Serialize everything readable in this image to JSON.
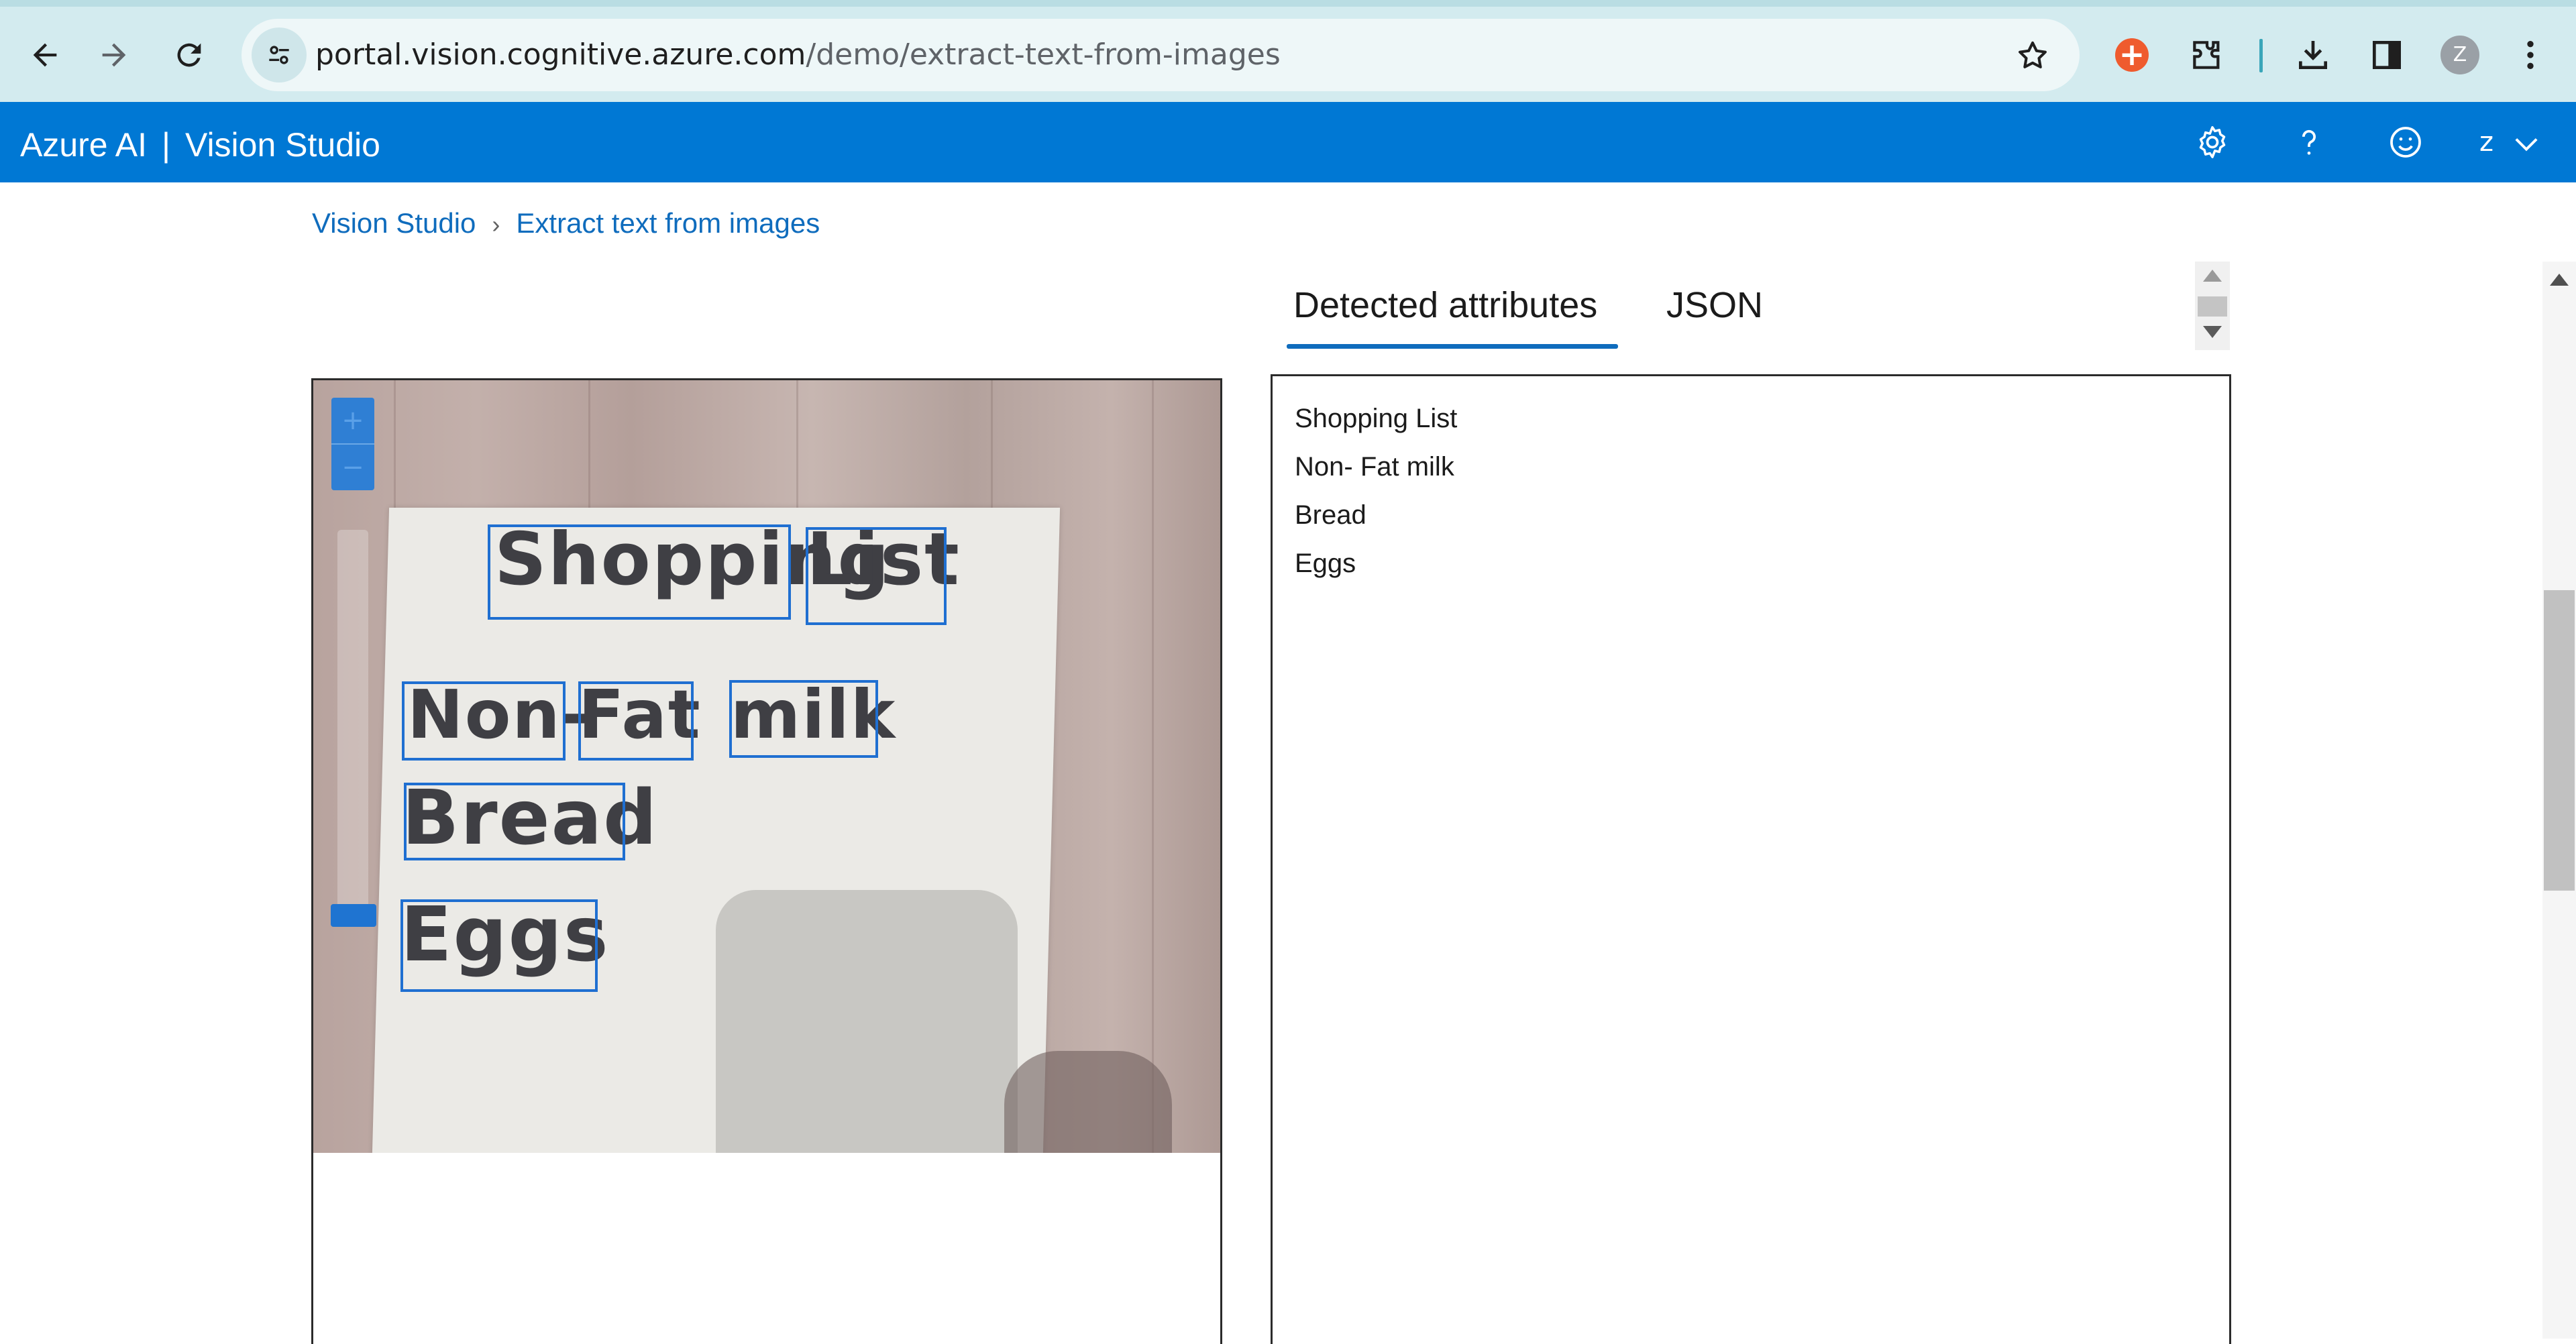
{
  "browser": {
    "url_host": "portal.vision.cognitive.azure.com",
    "url_path": "/demo/extract-text-from-images",
    "profile_initial": "Z",
    "icons": [
      "back-icon",
      "forward-icon",
      "reload-icon",
      "site-info-icon",
      "bookmark-star-icon",
      "extension-red-icon",
      "extensions-puzzle-icon",
      "download-icon",
      "side-panel-icon",
      "profile-avatar",
      "menu-kebab-icon"
    ]
  },
  "app": {
    "brand_left": "Azure AI",
    "brand_sep": "|",
    "brand_right": "Vision Studio",
    "user_initial": "z",
    "accent_color": "#0078d4"
  },
  "breadcrumb": {
    "home": "Vision Studio",
    "current": "Extract text from images"
  },
  "tabs": {
    "detected": "Detected attributes",
    "json": "JSON",
    "active": "detected"
  },
  "zoom": {
    "in": "+",
    "out": "−"
  },
  "image_words": [
    "Shopping",
    "List",
    "Non-",
    "Fat",
    "milk",
    "Bread",
    "Eggs"
  ],
  "results": {
    "lines": [
      "Shopping List",
      "Non- Fat milk",
      "Bread",
      "Eggs"
    ]
  }
}
